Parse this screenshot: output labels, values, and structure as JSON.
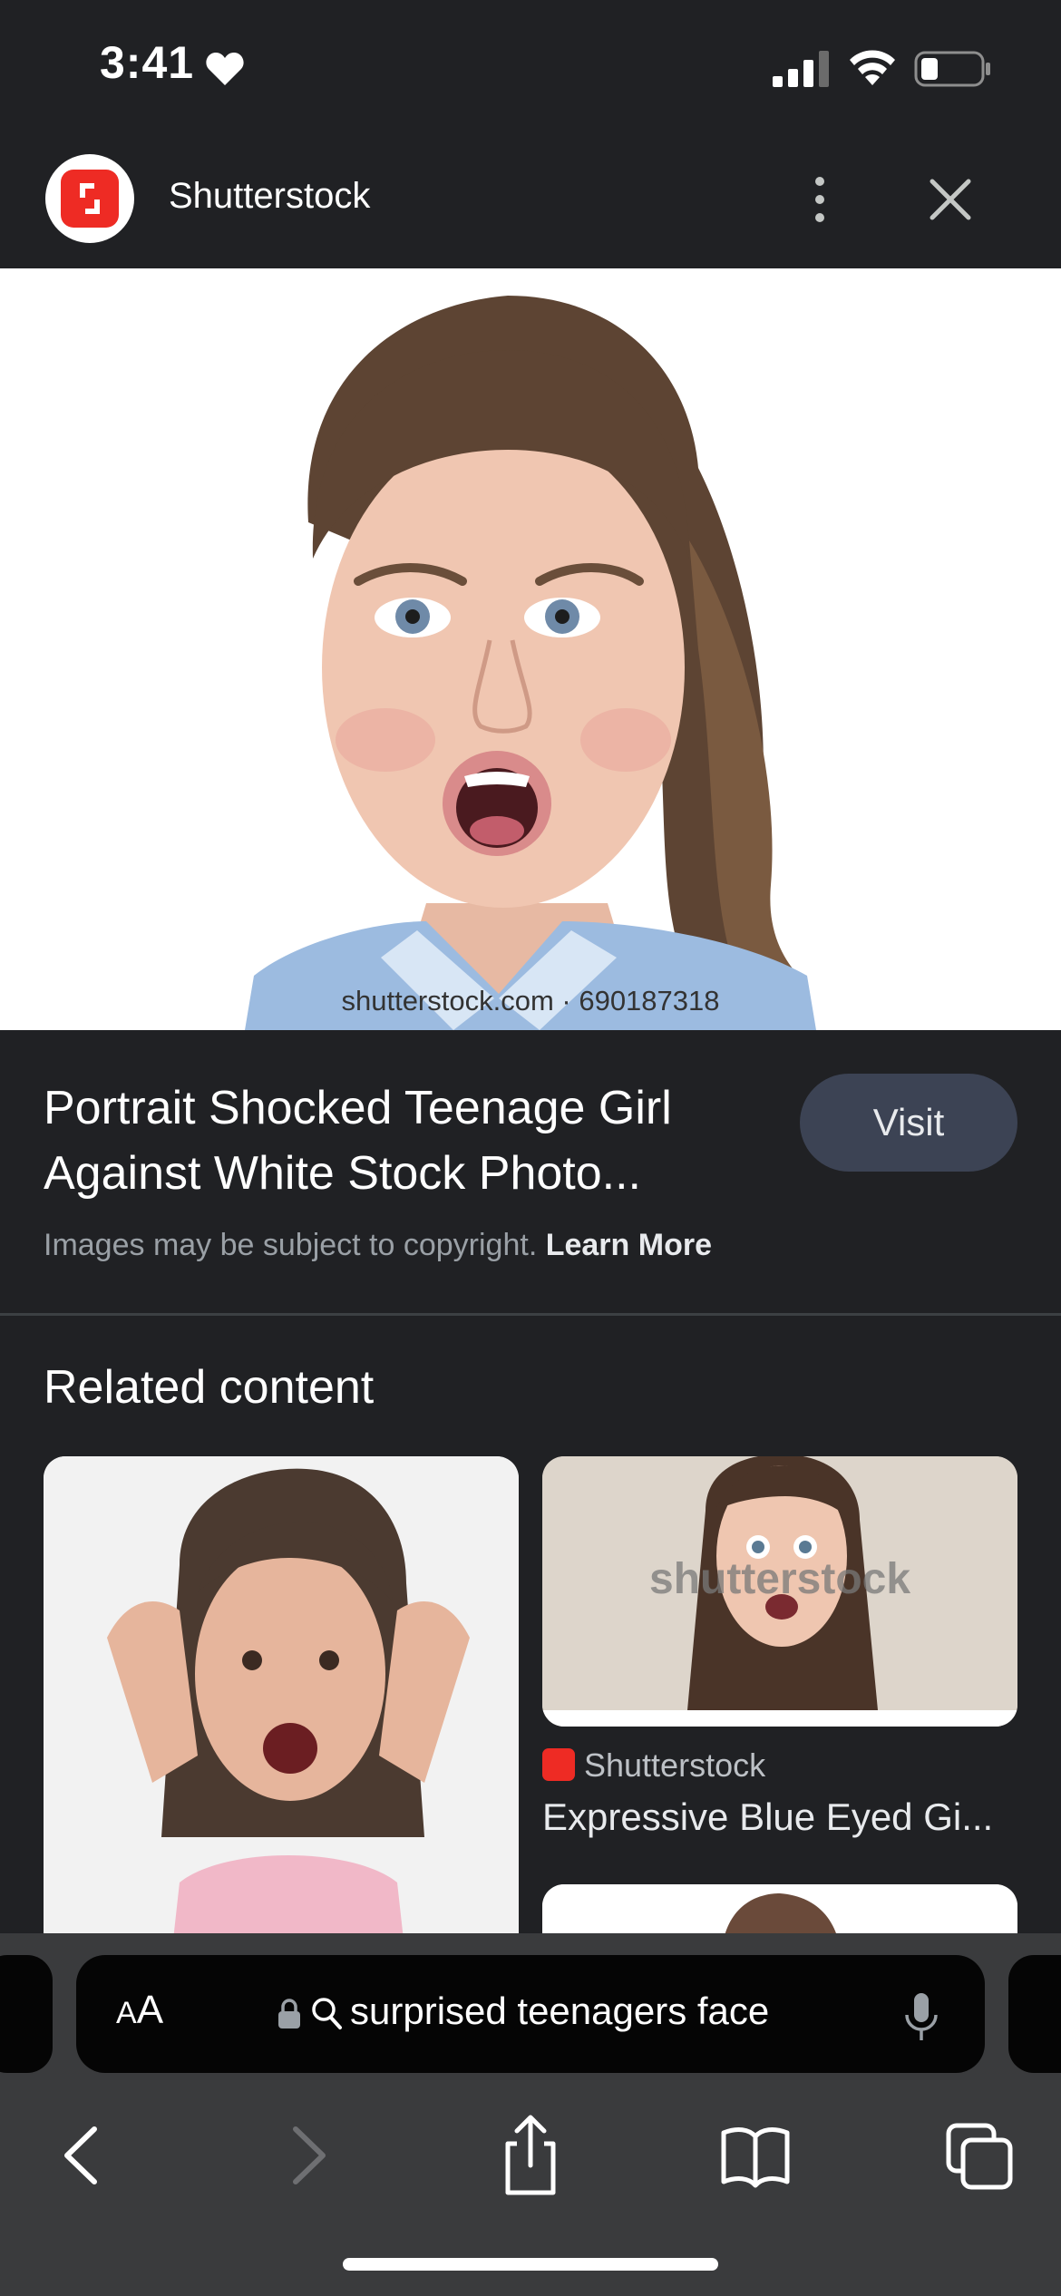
{
  "status_bar": {
    "time": "3:41"
  },
  "header": {
    "site_name": "Shutterstock",
    "logo_color": "#ee2b24"
  },
  "hero": {
    "watermark": "shutterstock.com · 690187318"
  },
  "info": {
    "title": "Portrait Shocked Teenage Girl Against White Stock Photo...",
    "visit_label": "Visit",
    "copyright_text": "Images may be subject to copyright. ",
    "learn_more_label": "Learn More"
  },
  "related": {
    "heading": "Related content",
    "cards": [
      {
        "source": "Shutterstock",
        "title": "Expressive Blue Eyed Gi..."
      }
    ],
    "right_card_watermark": "shutterstock"
  },
  "toolbar": {
    "aa_small": "A",
    "aa_large": "A",
    "url": "surprised teenagers face",
    "icons": [
      "lock-icon",
      "search-icon",
      "mic-icon",
      "back-icon",
      "forward-icon",
      "share-icon",
      "bookmarks-icon",
      "tabs-icon"
    ]
  },
  "colors": {
    "background": "#202124",
    "visit_button": "#3c4354",
    "toolbar": "#3a3b3d"
  }
}
